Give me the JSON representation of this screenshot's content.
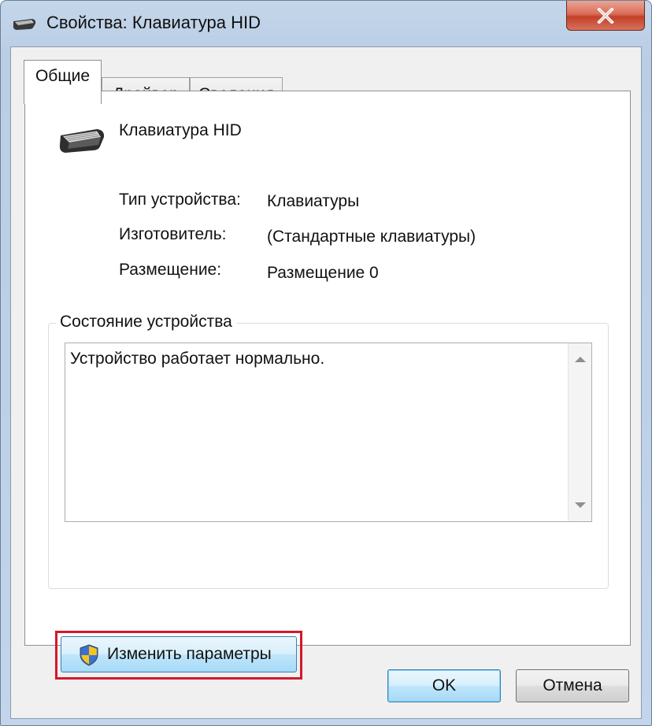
{
  "window": {
    "title": "Свойства: Клавиатура HID",
    "close_icon": "close-icon"
  },
  "tabs": [
    {
      "label": "Общие",
      "active": true
    },
    {
      "label": "Драйвер",
      "active": false
    },
    {
      "label": "Сведения",
      "active": false
    }
  ],
  "device": {
    "icon": "keyboard-icon",
    "name": "Клавиатура HID",
    "properties": [
      {
        "label": "Тип устройства:",
        "value": "Клавиатуры"
      },
      {
        "label": "Изготовитель:",
        "value": "(Стандартные клавиатуры)"
      },
      {
        "label": "Размещение:",
        "value": "Размещение 0"
      }
    ]
  },
  "status_group": {
    "title": "Состояние устройства",
    "text": "Устройство работает нормально."
  },
  "change_settings": {
    "icon": "uac-shield-icon",
    "label": "Изменить параметры",
    "highlight_color": "#d3192a"
  },
  "buttons": {
    "ok_label": "OK",
    "cancel_label": "Отмена"
  },
  "colors": {
    "title_bar": "#bcd0e6",
    "close_button": "#c4402a",
    "dialog_background": "#f0f0f0",
    "button_accent": "#3c7fb1"
  }
}
